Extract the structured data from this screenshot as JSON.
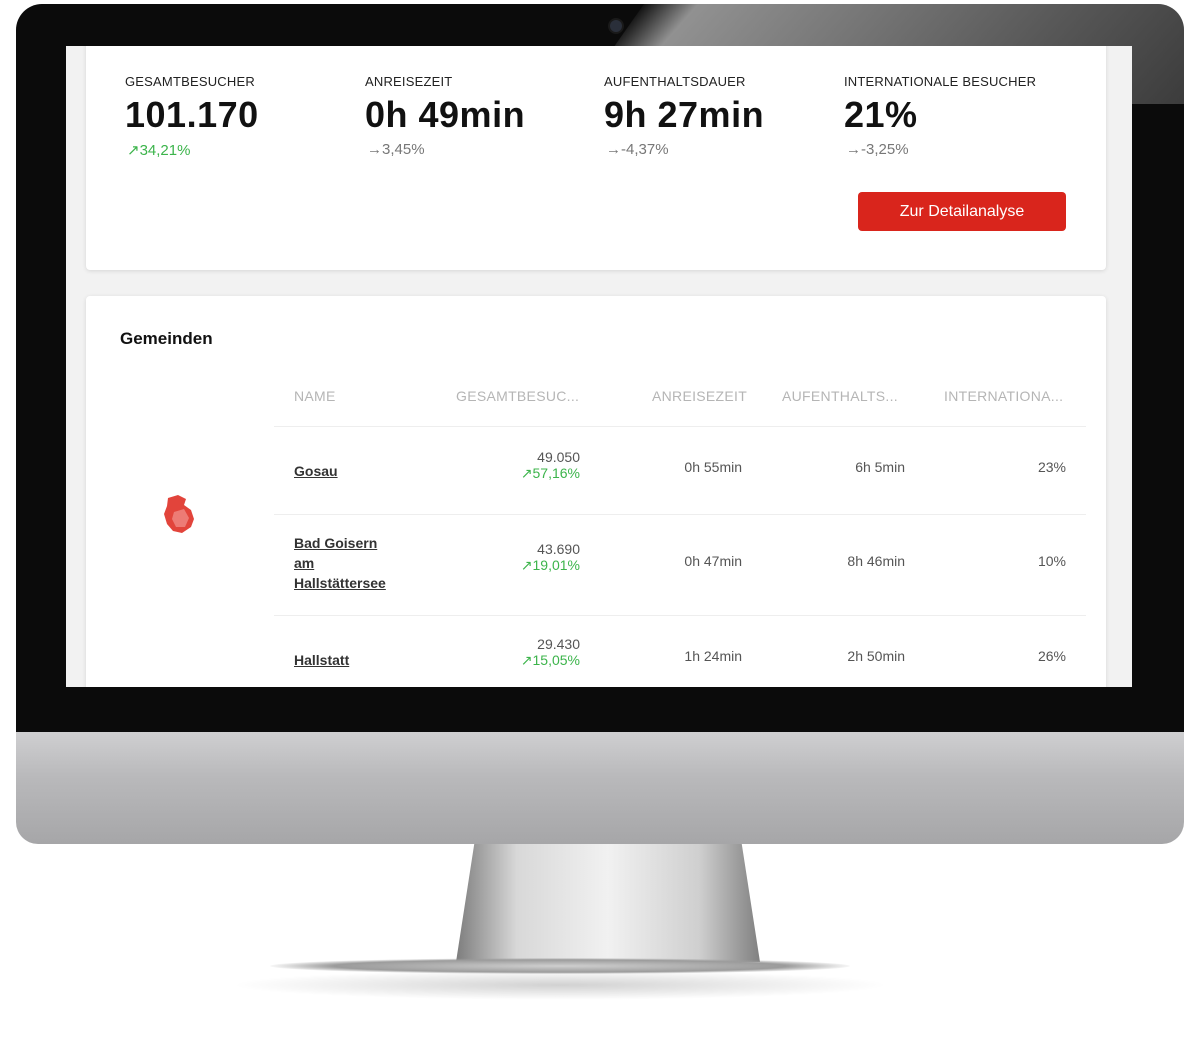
{
  "kpis": [
    {
      "label": "GESAMTBESUCHER",
      "value": "101.170",
      "delta": "↗34,21%"
    },
    {
      "label": "ANREISEZEIT",
      "value": "0h 49min",
      "delta": "→3,45%"
    },
    {
      "label": "AUFENTHALTSDAUER",
      "value": "9h 27min",
      "delta": "→-4,37%"
    },
    {
      "label": "INTERNATIONALE BESUCHER",
      "value": "21%",
      "delta": "→-3,25%"
    }
  ],
  "detail_button": "Zur Detailanalyse",
  "section_title": "Gemeinden",
  "table": {
    "headers": [
      "NAME",
      "GESAMTBESUC...",
      "ANREISEZEIT",
      "AUFENTHALTS...",
      "INTERNATIONA..."
    ],
    "rows": [
      {
        "name": "Gosau",
        "visitors": "49.050",
        "change": "↗57,16%",
        "travel": "0h 55min",
        "stay": "6h 5min",
        "intl": "23%"
      },
      {
        "name_lines": [
          "Bad Goisern",
          "am",
          "Hallstättersee"
        ],
        "visitors": "43.690",
        "change": "↗19,01%",
        "travel": "0h 47min",
        "stay": "8h 46min",
        "intl": "10%"
      },
      {
        "name": "Hallstatt",
        "visitors": "29.430",
        "change": "↗15,05%",
        "travel": "1h 24min",
        "stay": "2h 50min",
        "intl": "26%"
      }
    ]
  },
  "colors": {
    "accent_red": "#d9251c",
    "positive_green": "#3cb44b"
  }
}
